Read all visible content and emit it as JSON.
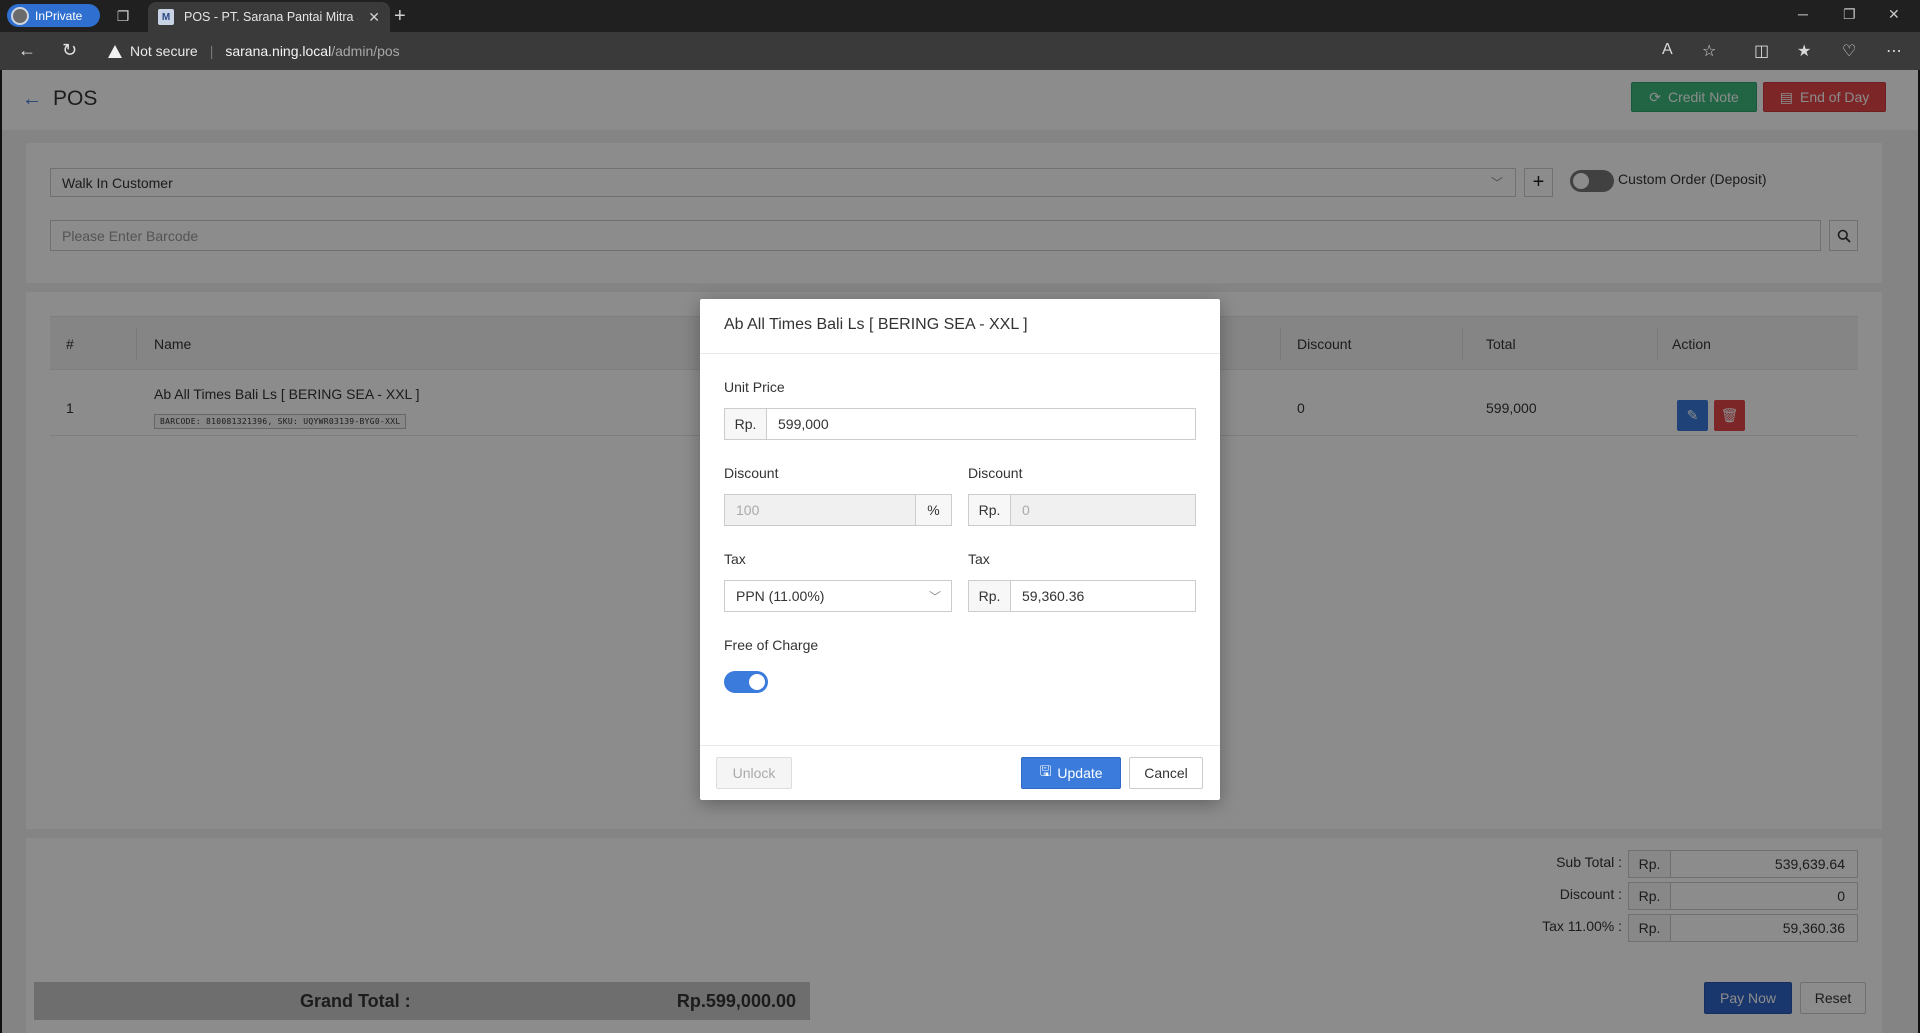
{
  "browser": {
    "inprivate_label": "InPrivate",
    "tab_title": "POS - PT. Sarana Pantai Mitra Se",
    "favicon_text": "M",
    "not_secure_label": "Not secure",
    "url_host": "sarana.ning.local",
    "url_path": "/admin/pos"
  },
  "header": {
    "title": "POS",
    "credit_note_label": "Credit Note",
    "end_of_day_label": "End of Day"
  },
  "customer": {
    "selected": "Walk In Customer",
    "custom_order_label": "Custom Order (Deposit)",
    "custom_order_on": false
  },
  "barcode": {
    "placeholder": "Please Enter Barcode"
  },
  "table": {
    "columns": [
      "#",
      "Name",
      "Discount",
      "Total",
      "Action"
    ],
    "rows": [
      {
        "index": "1",
        "name": "Ab All Times Bali Ls [ BERING SEA - XXL ]",
        "codes": "BARCODE: 810081321396, SKU: UQYWR03139-BYG0-XXL",
        "discount": "0",
        "total": "599,000"
      }
    ]
  },
  "summary": {
    "subtotal_label": "Sub Total :",
    "subtotal_prefix": "Rp.",
    "subtotal_value": "539,639.64",
    "discount_label": "Discount :",
    "discount_prefix": "Rp.",
    "discount_value": "0",
    "tax_label": "Tax 11.00% :",
    "tax_prefix": "Rp.",
    "tax_value": "59,360.36",
    "grand_total_label": "Grand Total :",
    "grand_total_value": "Rp.599,000.00",
    "pay_now_label": "Pay Now",
    "reset_label": "Reset"
  },
  "modal": {
    "title": "Ab All Times Bali Ls [ BERING SEA - XXL ]",
    "unit_price_label": "Unit Price",
    "unit_price_prefix": "Rp.",
    "unit_price_value": "599,000",
    "discount_pct_label": "Discount",
    "discount_pct_placeholder": "100",
    "discount_pct_suffix": "%",
    "discount_amt_label": "Discount",
    "discount_amt_prefix": "Rp.",
    "discount_amt_placeholder": "0",
    "tax_type_label": "Tax",
    "tax_type_value": "PPN (11.00%)",
    "tax_amt_label": "Tax",
    "tax_amt_prefix": "Rp.",
    "tax_amt_value": "59,360.36",
    "free_of_charge_label": "Free of Charge",
    "free_of_charge_on": true,
    "unlock_label": "Unlock",
    "update_label": "Update",
    "cancel_label": "Cancel"
  },
  "colors": {
    "primary": "#3a7bdc",
    "success": "#3cb87c",
    "danger": "#e2454a",
    "pay_now": "#2f63c7"
  }
}
